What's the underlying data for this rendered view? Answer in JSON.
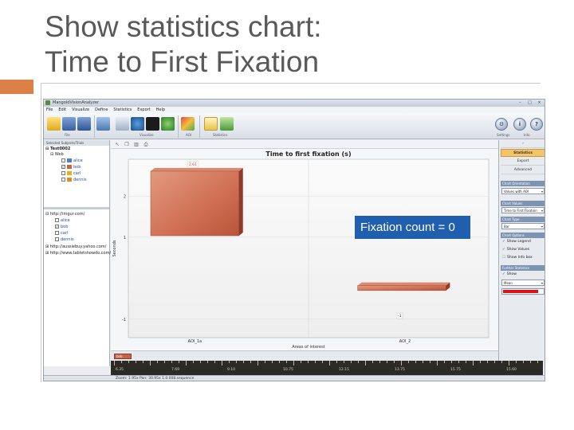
{
  "slide": {
    "title_line1": "Show statistics chart:",
    "title_line2": "Time to First Fixation",
    "accent_color": "#dd8047"
  },
  "app": {
    "window_title": "MangoldVisionAnalyzer",
    "window_buttons": [
      "–",
      "□",
      "×"
    ],
    "menu": [
      "File",
      "Edit",
      "Visualize",
      "Define",
      "Statistics",
      "Export",
      "Help"
    ],
    "ribbon_groups": [
      "File",
      "Visualize",
      "AOI",
      "Statistics",
      "Settings",
      "Info"
    ],
    "round_buttons": [
      {
        "icon": "settings-gear-icon",
        "glyph": "⚙"
      },
      {
        "icon": "info-icon",
        "glyph": "i"
      },
      {
        "icon": "help-icon",
        "glyph": "?"
      }
    ]
  },
  "left_panel": {
    "header": "Selected Subjects/Trials",
    "subject": "Test0002",
    "group": "Web",
    "items": [
      {
        "name": "alice",
        "checked": false,
        "color": "#4d7fc4"
      },
      {
        "name": "bob",
        "checked": true,
        "color": "#c0654a"
      },
      {
        "name": "carl",
        "checked": false,
        "color": "#e0b020"
      },
      {
        "name": "dennis",
        "checked": false,
        "color": "#e08a20"
      }
    ],
    "url1": "http://imgur.com/",
    "url1_items": [
      {
        "name": "alice",
        "checked": false
      },
      {
        "name": "bob",
        "checked": true
      },
      {
        "name": "carl",
        "checked": false
      },
      {
        "name": "dennis",
        "checked": false
      }
    ],
    "url2": "http://aussiebuy.yahoo.com/",
    "url3": "http://www.tabletshowdo.com/"
  },
  "right_panel": {
    "tabs": [
      {
        "label": "Statistics",
        "active": true
      },
      {
        "label": "Export",
        "active": false
      },
      {
        "label": "Advanced",
        "active": false
      }
    ],
    "orientation_head": "Chart Orientation",
    "orientation_value": "Values with AOI",
    "values_head": "Chart Values",
    "values_value": "Time to First Fixation",
    "type_head": "Chart Type",
    "type_value": "Bar",
    "options_head": "Chart Options",
    "options": [
      {
        "label": "Show Legend",
        "checked": true
      },
      {
        "label": "Show Values",
        "checked": true
      },
      {
        "label": "Show Info box",
        "checked": false
      }
    ],
    "further_head": "Further Statistics",
    "further_show": "Show",
    "further_value": "Mean",
    "series_color": "#e01010"
  },
  "chart_data": {
    "type": "bar",
    "title": "Time to first fixation (s)",
    "xlabel": "Areas of interest",
    "ylabel": "Seconds",
    "categories": [
      "AOI_1a",
      "AOI_2"
    ],
    "series": [
      {
        "name": "bob",
        "values": [
          2.61,
          -1
        ],
        "color": "#c9694d"
      }
    ],
    "value_labels": [
      "2.61",
      "-1"
    ],
    "y_ticks": [
      2,
      1,
      -1
    ],
    "ylim": [
      -1.45,
      2.9
    ],
    "grid": true,
    "legend": "bottom-left",
    "tooltip": "Fixation count = 0"
  },
  "legend_strip": {
    "label": "bob"
  },
  "timeline": {
    "labels": [
      "6.35",
      "7.69",
      "9.10",
      "10.75",
      "12.15",
      "13.75",
      "15.75",
      "15.60"
    ]
  },
  "status": {
    "text": "Zoom: 1.95x  Pan: 30.95x  1.0.008.sequence"
  }
}
